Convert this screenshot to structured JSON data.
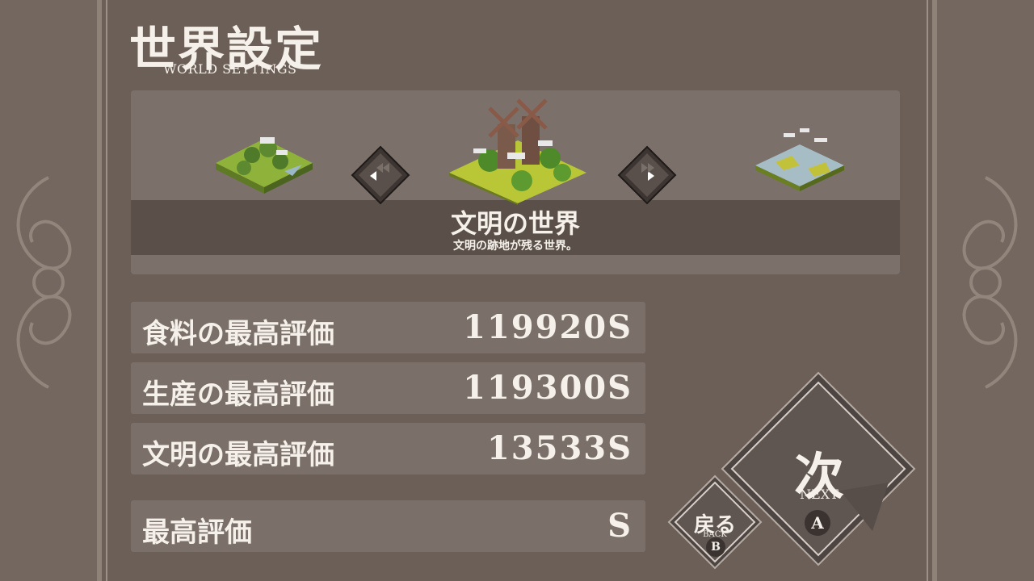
{
  "header": {
    "title": "世界設定",
    "subtitle": "WORLD SETTINGS"
  },
  "world": {
    "name": "文明の世界",
    "description": "文明の跡地が残る世界。",
    "prev_icon": "prev-arrow-icon",
    "next_icon": "next-arrow-icon"
  },
  "stats": [
    {
      "label": "食料の最高評価",
      "value": "119920S"
    },
    {
      "label": "生産の最高評価",
      "value": "119300S"
    },
    {
      "label": "文明の最高評価",
      "value": "13533S"
    },
    {
      "label": "最高評価",
      "value": "S"
    }
  ],
  "buttons": {
    "next": {
      "label": "次",
      "sub": "NEXT",
      "key": "A"
    },
    "back": {
      "label": "戻る",
      "sub": "BACK",
      "key": "B"
    }
  },
  "colors": {
    "background": "#6b5f58",
    "panel": "#7c706a",
    "band": "#5a4f49",
    "grass": "#8fb23a",
    "water": "#9cb8c6"
  }
}
